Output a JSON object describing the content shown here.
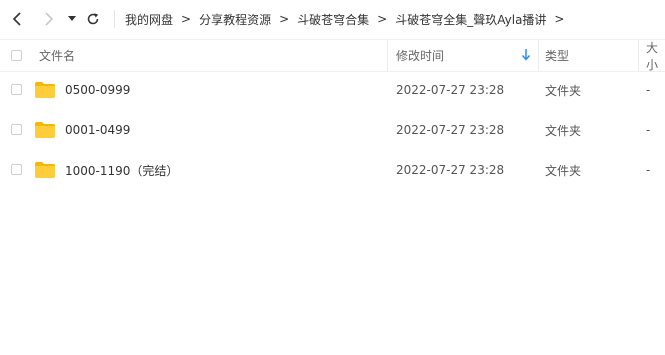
{
  "nav": {
    "back_icon": "chevron-left-icon",
    "forward_icon": "chevron-right-icon",
    "dropdown_icon": "caret-down-icon",
    "refresh_icon": "refresh-icon"
  },
  "breadcrumb": {
    "items": [
      "我的网盘",
      "分享教程资源",
      "斗破苍穹合集",
      "斗破苍穹全集_聲玖Ayla播讲"
    ],
    "separator": ">"
  },
  "columns": {
    "name": "文件名",
    "modified": "修改时间",
    "type": "类型",
    "size": "大小"
  },
  "files": [
    {
      "name": "0500-0999",
      "modified": "2022-07-27 23:28",
      "type": "文件夹",
      "size": "-"
    },
    {
      "name": "0001-0499",
      "modified": "2022-07-27 23:28",
      "type": "文件夹",
      "size": "-"
    },
    {
      "name": "1000-1190（完结）",
      "modified": "2022-07-27 23:28",
      "type": "文件夹",
      "size": "-"
    }
  ],
  "colors": {
    "folder": "#FFCD3C",
    "folder_dark": "#F5B800",
    "sort_arrow": "#2D8CF0"
  }
}
